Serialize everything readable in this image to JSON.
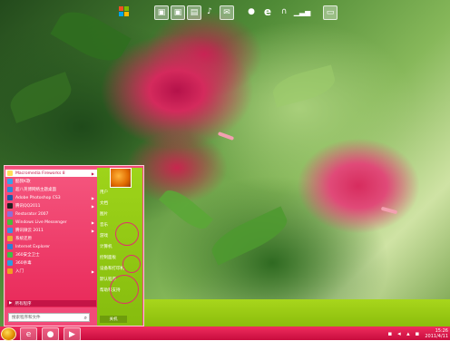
{
  "desktop": {
    "wallpaper": "hibiscus-flowers"
  },
  "quicklaunch": {
    "icons": [
      "windows-icon",
      "media-icon",
      "photo-icon",
      "folder-icon",
      "music-icon",
      "mail-icon",
      "chat-icon",
      "ie-icon",
      "headphones-icon",
      "chart-icon",
      "doc-icon"
    ]
  },
  "start_menu": {
    "programs": [
      {
        "label": "Macromedia Fireworks 8",
        "icon": "fireworks-icon",
        "color": "#ffde5a",
        "submenu": true,
        "selected": true
      },
      {
        "label": "酷我K歌",
        "icon": "karaoke-icon",
        "color": "#3aa0e8",
        "submenu": false
      },
      {
        "label": "超八英博网络主题桌面",
        "icon": "theme-icon",
        "color": "#2f8ad9",
        "submenu": false
      },
      {
        "label": "Adobe Photoshop CS3",
        "icon": "photoshop-icon",
        "color": "#1d5aa8",
        "submenu": true
      },
      {
        "label": "腾讯QQ2011",
        "icon": "qq-icon",
        "color": "#222222",
        "submenu": true
      },
      {
        "label": "Restorator 2007",
        "icon": "restorator-icon",
        "color": "#8e6fd6",
        "submenu": false
      },
      {
        "label": "Windows Live Messenger",
        "icon": "messenger-icon",
        "color": "#4cbb3a",
        "submenu": true
      },
      {
        "label": "腾讯微云 2011",
        "icon": "cloud-icon",
        "color": "#3d8ee0",
        "submenu": true
      },
      {
        "label": "系统还原",
        "icon": "restore-icon",
        "color": "#e6b230",
        "submenu": false
      },
      {
        "label": "Internet Explorer",
        "icon": "ie-icon",
        "color": "#2d7fd6",
        "submenu": false
      },
      {
        "label": "360安全卫士",
        "icon": "shield-icon",
        "color": "#3fbf47",
        "submenu": false
      },
      {
        "label": "360杀毒",
        "icon": "antivirus-icon",
        "color": "#2c9de0",
        "submenu": false
      },
      {
        "label": "入门",
        "icon": "windows-icon",
        "color": "#f0a020",
        "submenu": true
      }
    ],
    "all_programs": "所有程序",
    "search_placeholder": "搜索程序和文件",
    "right_items": [
      "用户",
      "文档",
      "图片",
      "音乐",
      "游戏",
      "计算机",
      "控制面板",
      "设备和打印机",
      "默认程序",
      "帮助和支持"
    ],
    "shutdown_label": "关机"
  },
  "taskbar": {
    "pinned": [
      "ie-icon",
      "qq-icon",
      "media-icon"
    ],
    "clock_time": "15:26",
    "clock_date": "2011/4/11"
  },
  "colors": {
    "taskbar": "#e0184a",
    "menu_left": "#f24a78",
    "menu_right": "#94c914",
    "accent_bar": "#9ccb12"
  }
}
